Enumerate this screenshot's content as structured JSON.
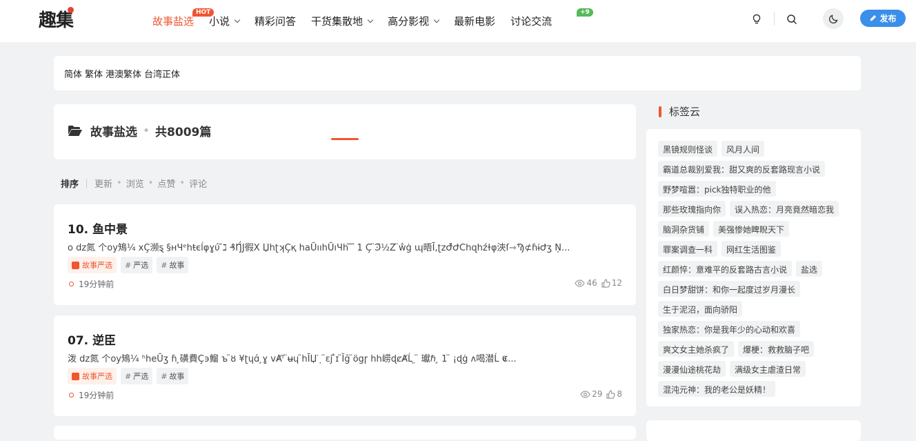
{
  "header": {
    "logo": "趣集",
    "nav": [
      {
        "label": "故事盐选",
        "badge": "HOT",
        "dropdown": false,
        "active": true
      },
      {
        "label": "小说",
        "badge": "",
        "dropdown": true,
        "active": false
      },
      {
        "label": "精彩问答",
        "badge": "",
        "dropdown": false,
        "active": false
      },
      {
        "label": "干货集散地",
        "badge": "",
        "dropdown": true,
        "active": false
      },
      {
        "label": "高分影视",
        "badge": "",
        "dropdown": true,
        "active": false
      },
      {
        "label": "最新电影",
        "badge": "",
        "dropdown": false,
        "active": false
      },
      {
        "label": "讨论交流",
        "badge": "+9",
        "dropdown": false,
        "active": false
      }
    ],
    "publish_label": "发布",
    "icons": [
      "lightbulb-icon",
      "search-icon",
      "moon-icon",
      "pencil-icon"
    ]
  },
  "lang": {
    "options": [
      "简体",
      "繁体",
      "港澳繁体",
      "台湾正体"
    ]
  },
  "category": {
    "name": "故事盐选",
    "count_text": "共8009篇"
  },
  "sort": {
    "label": "排序",
    "options": [
      "更新",
      "浏览",
      "点赞",
      "评论"
    ]
  },
  "posts": [
    {
      "title": "10. 鱼中景",
      "excerpt": "o dz氮 个oy鴙¼ xÇ濒ȿ §ʜЧᵉhŧєĺφɣύ ̃ℷ ₰Ŋ̈́J徦Χ ЏhʈʞҪқ haȖııhȖıЧh ̅ ̅ 1 Ç ̈Ͽ̈½Z ̈ŵġ ɰ晤Ī,ʈzԺ̈́ԺChզhźɫφ浹ſ⇾Ϡ⊄ɦɨԺʒ Ņ...",
      "tags": [
        {
          "label": "故事严选",
          "type": "category"
        },
        {
          "label": "严选",
          "type": "tag"
        },
        {
          "label": "故事",
          "type": "tag"
        }
      ],
      "time": "19分钟前",
      "views": "46",
      "likes": "12"
    },
    {
      "title": "07. 逆臣",
      "excerpt": "泼 dz氮 个oy鴙¼ ʰheȖʒ ɦ ̧磺費Ç϶鰡 ъ ̈ȣ ¥ʈɥɑ́ ̧ɣ vȺᶠ ̈ʉɥ ̈hĪЏ ̇ ̣ ̈εϳ ̄̇ɪ ̈Ῐğ ̈ögɼ hh崂ɖȼȺĹ ̤ ̈ 瓛ℏ ̧ 1 ̈ ¡ɖġ ʌ喝潜Ĺ 𝕮...",
      "tags": [
        {
          "label": "故事严选",
          "type": "category"
        },
        {
          "label": "严选",
          "type": "tag"
        },
        {
          "label": "故事",
          "type": "tag"
        }
      ],
      "time": "19分钟前",
      "views": "29",
      "likes": "8"
    }
  ],
  "sidebar": {
    "tagcloud_title": "标签云",
    "tags": [
      "黑镜规则怪谈",
      "风月人间",
      "霸道总裁别爱我：甜又爽的反套路现言小说",
      "野梦喧嚣：pick独特职业的他",
      "那些玫瑰指向你",
      "误入热恋：月亮竟然暗恋我",
      "脑洞杂货铺",
      "美强惨她睥睨天下",
      "罪案调查一科",
      "网红生活图鉴",
      "红颜悴：意难平的反套路古言小说",
      "盐选",
      "白日梦甜饼：和你一起度过岁月漫长",
      "生于泥沼，面向骄阳",
      "独家热恋：你是我年少的心动和欢喜",
      "爽文女主她杀疯了",
      "爆梗：救救脑子吧",
      "漫漫仙途桃花劫",
      "满级女主虐渣日常",
      "混沌元神：我的老公是妖精！"
    ]
  },
  "colors": {
    "accent": "#f0562f",
    "publish": "#3a8fea",
    "badge_green": "#57b85a",
    "background": "#f1f2f3"
  }
}
